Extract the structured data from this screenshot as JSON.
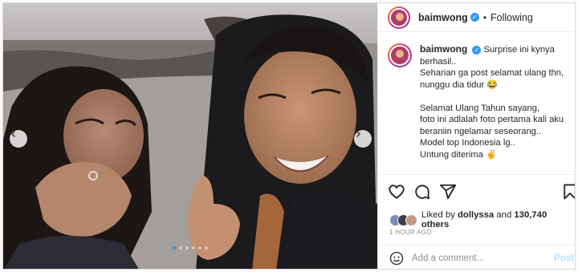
{
  "post": {
    "username": "baimwong",
    "verified_symbol": "✓",
    "separator": "•",
    "follow_status": "Following"
  },
  "caption": {
    "username": "baimwong",
    "lines_block1": [
      "Surprise ini kynya berhasil..",
      "Seharian ga post selamat ulang thn, nunggu dia tidur 😂"
    ],
    "lines_block2": [
      "Selamat Ulang Tahun sayang,",
      "foto ini adlalah foto pertama kali aku beraniin ngelamar seseorang..",
      "Model top Indonesia lg..",
      "Untung diterima ✌️"
    ]
  },
  "likes": {
    "prefix": "Liked by",
    "user": "dollyssa",
    "mid": "and",
    "count": "130,740 others"
  },
  "timestamp": "1 HOUR AGO",
  "comment_box": {
    "placeholder": "Add a comment...",
    "post_label": "Post"
  },
  "carousel": {
    "dot_count": 6,
    "active_index": 0
  },
  "icons": {
    "like": "heart-icon",
    "comment": "comment-icon",
    "share": "share-icon",
    "save": "bookmark-icon",
    "emoji": "smiley-icon",
    "prev": "chevron-left-icon",
    "next": "chevron-right-icon"
  },
  "colors": {
    "accent": "#3897f0",
    "post_disabled": "#b2dffc",
    "muted": "#8e8e8e"
  }
}
